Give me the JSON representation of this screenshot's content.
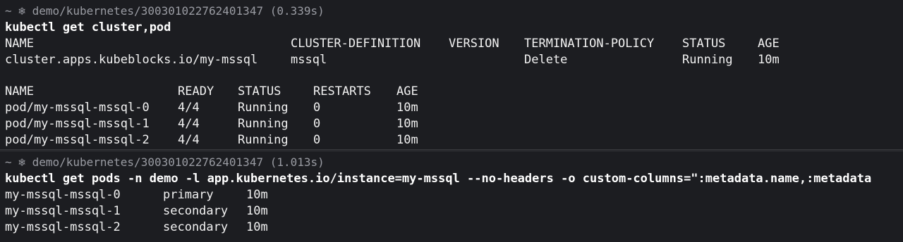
{
  "block1": {
    "prompt": {
      "tilde": "~",
      "icon": "snowflake-kubernetes-icon",
      "path": "demo/kubernetes/300301022762401347",
      "duration": "(0.339s)"
    },
    "command": "kubectl get cluster,pod",
    "cluster_table": {
      "headers": [
        "NAME",
        "CLUSTER-DEFINITION",
        "VERSION",
        "TERMINATION-POLICY",
        "STATUS",
        "AGE"
      ],
      "rows": [
        [
          "cluster.apps.kubeblocks.io/my-mssql",
          "mssql",
          "",
          "Delete",
          "Running",
          "10m"
        ]
      ]
    },
    "pod_table": {
      "headers": [
        "NAME",
        "READY",
        "STATUS",
        "RESTARTS",
        "AGE"
      ],
      "rows": [
        [
          "pod/my-mssql-mssql-0",
          "4/4",
          "Running",
          "0",
          "10m"
        ],
        [
          "pod/my-mssql-mssql-1",
          "4/4",
          "Running",
          "0",
          "10m"
        ],
        [
          "pod/my-mssql-mssql-2",
          "4/4",
          "Running",
          "0",
          "10m"
        ]
      ]
    }
  },
  "block2": {
    "prompt": {
      "tilde": "~",
      "icon": "snowflake-kubernetes-icon",
      "path": "demo/kubernetes/300301022762401347",
      "duration": "(1.013s)"
    },
    "command": "kubectl get pods -n demo -l app.kubernetes.io/instance=my-mssql --no-headers -o custom-columns=\":metadata.name,:metadata",
    "rows": [
      [
        "my-mssql-mssql-0",
        "primary",
        "10m"
      ],
      [
        "my-mssql-mssql-1",
        "secondary",
        "10m"
      ],
      [
        "my-mssql-mssql-2",
        "secondary",
        "10m"
      ]
    ]
  }
}
